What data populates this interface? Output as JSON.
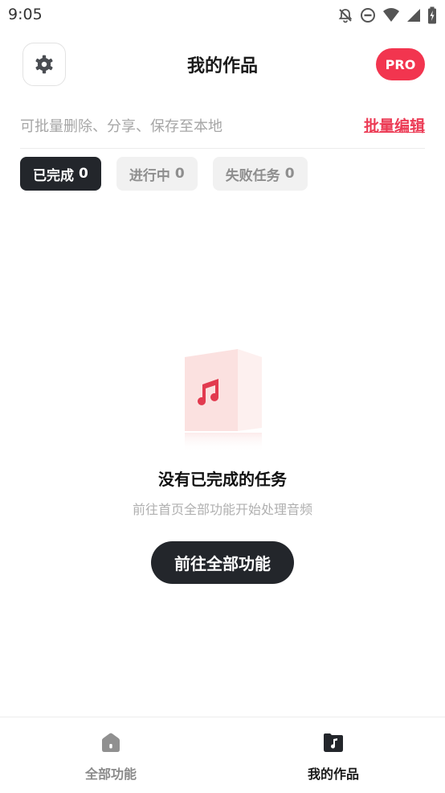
{
  "status_bar": {
    "time": "9:05"
  },
  "header": {
    "title": "我的作品",
    "pro_label": "PRO"
  },
  "hint": {
    "text": "可批量删除、分享、保存至本地",
    "batch_edit": "批量编辑"
  },
  "tabs": [
    {
      "label": "已完成",
      "count": "0",
      "active": true
    },
    {
      "label": "进行中",
      "count": "0",
      "active": false
    },
    {
      "label": "失败任务",
      "count": "0",
      "active": false
    }
  ],
  "empty_state": {
    "title": "没有已完成的任务",
    "subtitle": "前往首页全部功能开始处理音频",
    "button": "前往全部功能"
  },
  "bottom_nav": [
    {
      "label": "全部功能",
      "icon": "home-icon",
      "active": false
    },
    {
      "label": "我的作品",
      "icon": "music-folder-icon",
      "active": true
    }
  ],
  "colors": {
    "accent": "#f2354f",
    "dark": "#23262b",
    "link": "#ec3b55"
  }
}
